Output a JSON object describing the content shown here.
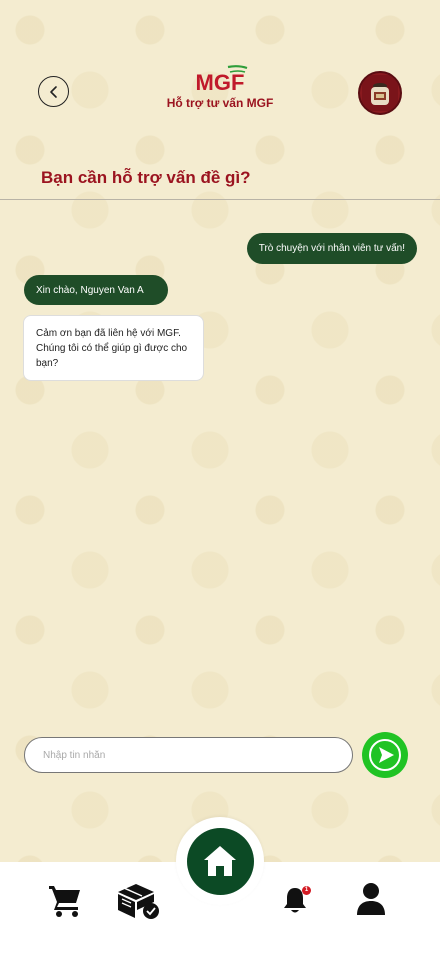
{
  "header": {
    "logo_text": "MGF",
    "title": "Hỗ trợ tư vấn MGF"
  },
  "question": "Bạn cần hỗ trợ vấn đề gì?",
  "chat": {
    "user_message": "Trò chuyện với nhân viên tư vấn!",
    "greeting": "Xin chào, Nguyen Van A",
    "reply": "Cảm ơn bạn đã liên hệ với MGF. Chúng tôi có thể giúp gì được cho bạn?"
  },
  "composer": {
    "placeholder": "Nhập tin nhắn",
    "value": ""
  },
  "nav": {
    "notification_badge": "1",
    "items": [
      "cart-icon",
      "order-confirmed-icon",
      "home-icon",
      "bell-icon",
      "user-icon"
    ]
  },
  "colors": {
    "brand_red": "#9b1420",
    "dark_green": "#1f4d28",
    "send_green": "#20c324",
    "home_green": "#0c4a25"
  }
}
